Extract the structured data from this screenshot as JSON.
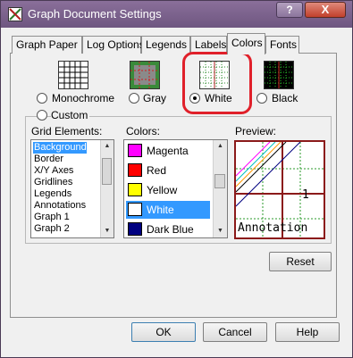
{
  "window": {
    "title": "Graph Document Settings",
    "help_label": "?",
    "close_label": "X"
  },
  "tabs": [
    {
      "label": "Graph Paper"
    },
    {
      "label": "Log Options"
    },
    {
      "label": "Legends"
    },
    {
      "label": "Labels"
    },
    {
      "label": "Colors",
      "active": true
    },
    {
      "label": "Fonts"
    }
  ],
  "color_scheme": {
    "options": [
      {
        "label": "Monochrome",
        "icon": "monochrome-grid-icon"
      },
      {
        "label": "Gray",
        "icon": "gray-grid-icon"
      },
      {
        "label": "White",
        "icon": "white-grid-icon",
        "selected": true
      },
      {
        "label": "Black",
        "icon": "black-grid-icon"
      }
    ],
    "custom_label": "Custom"
  },
  "grid_elements": {
    "label": "Grid Elements:",
    "items": [
      "Background",
      "Border",
      "X/Y Axes",
      "Gridlines",
      "Legends",
      "Annotations",
      "Graph 1",
      "Graph 2"
    ],
    "selected": "Background"
  },
  "colors": {
    "label": "Colors:",
    "items": [
      {
        "name": "Magenta",
        "hex": "#ff00ff"
      },
      {
        "name": "Red",
        "hex": "#ff0000"
      },
      {
        "name": "Yellow",
        "hex": "#ffff00"
      },
      {
        "name": "White",
        "hex": "#ffffff"
      },
      {
        "name": "Dark Blue",
        "hex": "#000080"
      }
    ],
    "selected": "White"
  },
  "preview": {
    "label": "Preview:",
    "axis_number": "1",
    "annotation_text": "Annotation"
  },
  "buttons": {
    "reset": "Reset",
    "ok": "OK",
    "cancel": "Cancel",
    "help": "Help"
  },
  "accent_colors": {
    "selection": "#3399ff",
    "highlight_ring": "#e0202a",
    "preview_border": "#8b1a1a"
  }
}
